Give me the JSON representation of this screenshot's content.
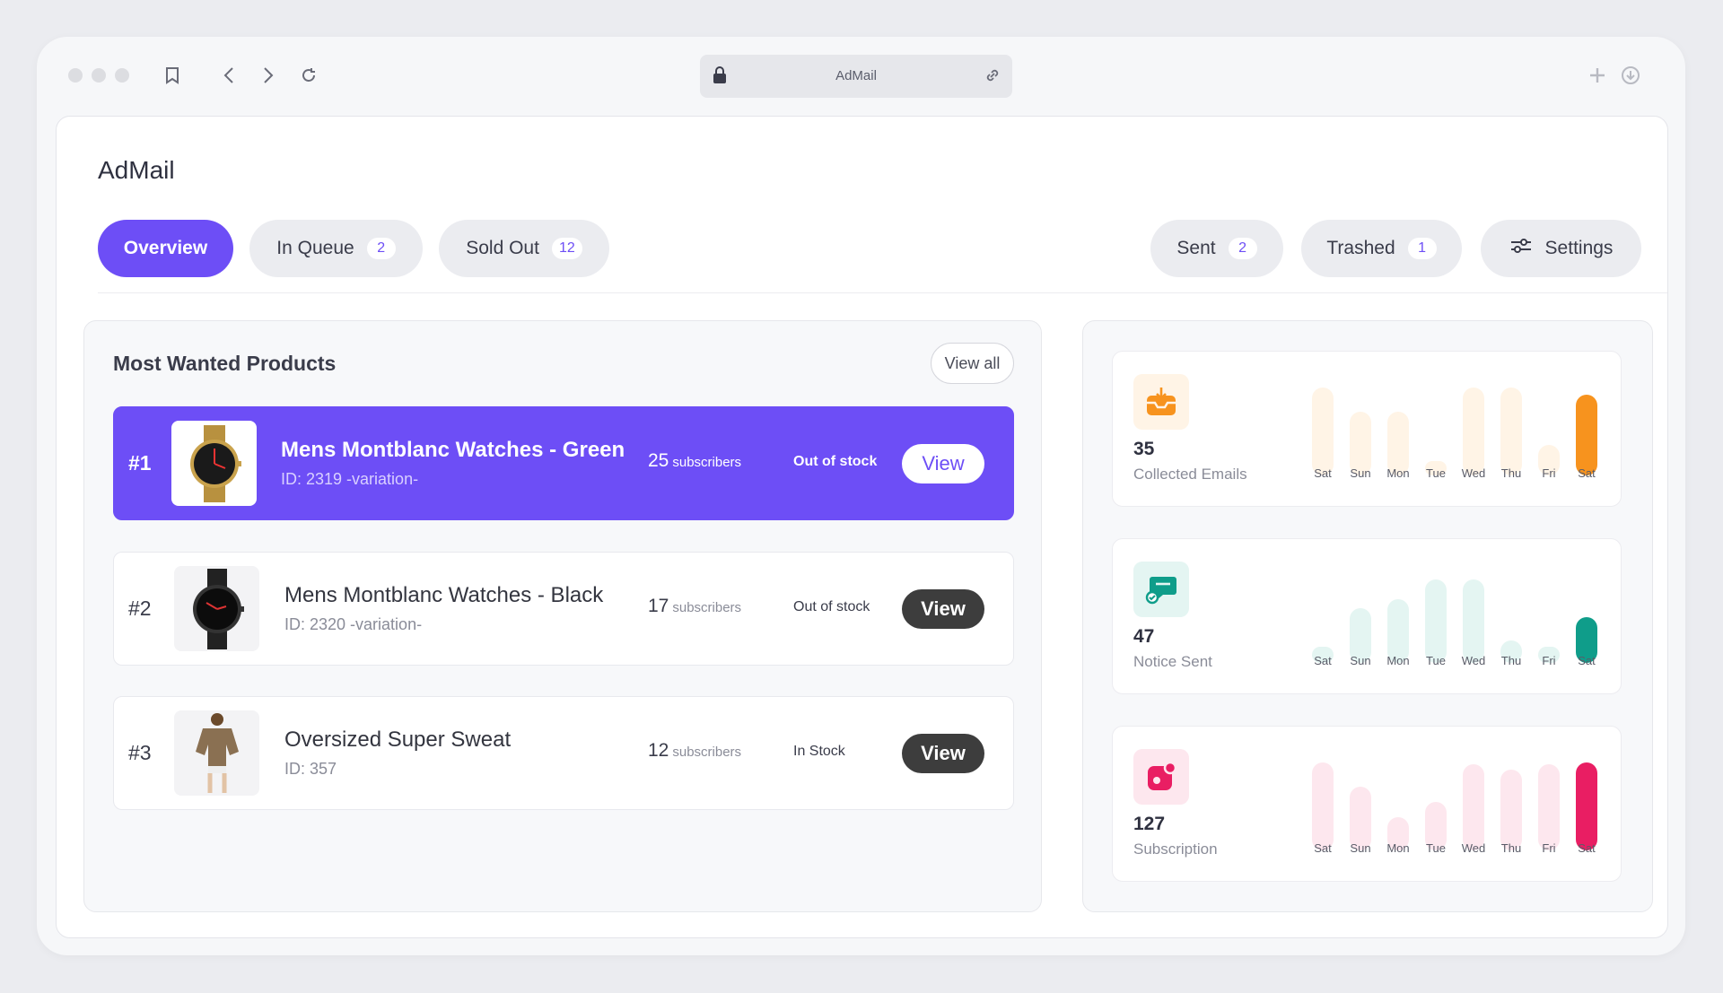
{
  "browser": {
    "url": "AdMail"
  },
  "app": {
    "title": "AdMail"
  },
  "tabs": [
    {
      "label": "Overview",
      "count": null
    },
    {
      "label": "In Queue",
      "count": "2"
    },
    {
      "label": "Sold Out",
      "count": "12"
    },
    {
      "label": "Sent",
      "count": "2"
    },
    {
      "label": "Trashed",
      "count": "1"
    },
    {
      "label": "Settings",
      "count": null
    }
  ],
  "products": {
    "title": "Most Wanted Products",
    "view_all": "View all",
    "subscribers_label": "subscribers",
    "view_label": "View",
    "rows": [
      {
        "rank": "#1",
        "name": "Mens Montblanc Watches - Green",
        "id": "ID: 2319 -variation-",
        "subscribers": "25",
        "stock": "Out of stock"
      },
      {
        "rank": "#2",
        "name": "Mens Montblanc Watches - Black",
        "id": "ID: 2320 -variation-",
        "subscribers": "17",
        "stock": "Out of stock"
      },
      {
        "rank": "#3",
        "name": "Oversized Super Sweat",
        "id": "ID: 357",
        "subscribers": "12",
        "stock": "In Stock"
      }
    ]
  },
  "stats": [
    {
      "value": "35",
      "label": "Collected Emails",
      "icon": "inbox-download-icon",
      "color": "#f7931e",
      "light": "#fff4e6",
      "days": [
        "Sat",
        "Sun",
        "Mon",
        "Tue",
        "Wed",
        "Thu",
        "Fri",
        "Sat"
      ],
      "levels": [
        1.0,
        0.72,
        0.72,
        0.15,
        1.0,
        1.0,
        0.35,
        0.92
      ]
    },
    {
      "value": "47",
      "label": "Notice Sent",
      "icon": "chat-check-icon",
      "color": "#0f9d8a",
      "light": "#e4f5f2",
      "days": [
        "Sat",
        "Sun",
        "Mon",
        "Tue",
        "Wed",
        "Thu",
        "Fri",
        "Sat"
      ],
      "levels": [
        0.18,
        0.62,
        0.72,
        0.95,
        0.95,
        0.25,
        0.18,
        0.52
      ]
    },
    {
      "value": "127",
      "label": "Subscription",
      "icon": "notification-app-icon",
      "color": "#e91e63",
      "light": "#fde7ee",
      "days": [
        "Sat",
        "Sun",
        "Mon",
        "Tue",
        "Wed",
        "Thu",
        "Fri",
        "Sat"
      ],
      "levels": [
        1.0,
        0.72,
        0.38,
        0.55,
        0.98,
        0.92,
        0.98,
        1.0
      ]
    }
  ]
}
